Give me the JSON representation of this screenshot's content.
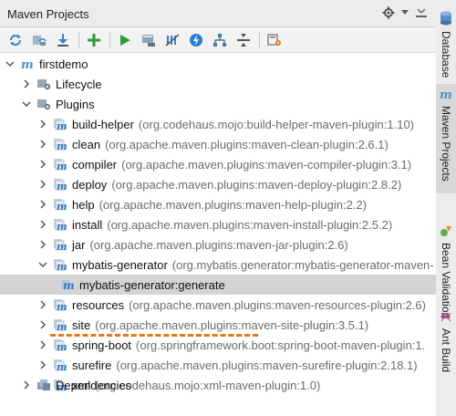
{
  "header": {
    "title": "Maven Projects"
  },
  "tree": {
    "root": "firstdemo",
    "lifecycle": "Lifecycle",
    "plugins": "Plugins",
    "plugin_list": [
      {
        "name": "build-helper",
        "coord": "(org.codehaus.mojo:build-helper-maven-plugin:1.10)"
      },
      {
        "name": "clean",
        "coord": "(org.apache.maven.plugins:maven-clean-plugin:2.6.1)"
      },
      {
        "name": "compiler",
        "coord": "(org.apache.maven.plugins:maven-compiler-plugin:3.1)"
      },
      {
        "name": "deploy",
        "coord": "(org.apache.maven.plugins:maven-deploy-plugin:2.8.2)"
      },
      {
        "name": "help",
        "coord": "(org.apache.maven.plugins:maven-help-plugin:2.2)"
      },
      {
        "name": "install",
        "coord": "(org.apache.maven.plugins:maven-install-plugin:2.5.2)"
      },
      {
        "name": "jar",
        "coord": "(org.apache.maven.plugins:maven-jar-plugin:2.6)"
      },
      {
        "name": "mybatis-generator",
        "coord": "(org.mybatis.generator:mybatis-generator-maven-"
      },
      {
        "name": "resources",
        "coord": "(org.apache.maven.plugins:maven-resources-plugin:2.6)"
      },
      {
        "name": "site",
        "coord": "(org.apache.maven.plugins:maven-site-plugin:3.5.1)"
      },
      {
        "name": "spring-boot",
        "coord": "(org.springframework.boot:spring-boot-maven-plugin:1."
      },
      {
        "name": "surefire",
        "coord": "(org.apache.maven.plugins:maven-surefire-plugin:2.18.1)"
      },
      {
        "name": "xml",
        "coord": "(org.codehaus.mojo:xml-maven-plugin:1.0)"
      }
    ],
    "goal": "mybatis-generator:generate",
    "dependencies": "Dependencies"
  },
  "sidebar": {
    "tabs": [
      {
        "label": "Database",
        "icon": "database-icon"
      },
      {
        "label": "Maven Projects",
        "icon": "maven-icon"
      },
      {
        "label": "Bean Validation",
        "icon": "bean-icon"
      },
      {
        "label": "Ant Build",
        "icon": "ant-icon"
      }
    ]
  },
  "colors": {
    "selection": "#d4d4d4",
    "highlight_dash": "#e07a1a",
    "maven_icon": "#4a90c8"
  }
}
